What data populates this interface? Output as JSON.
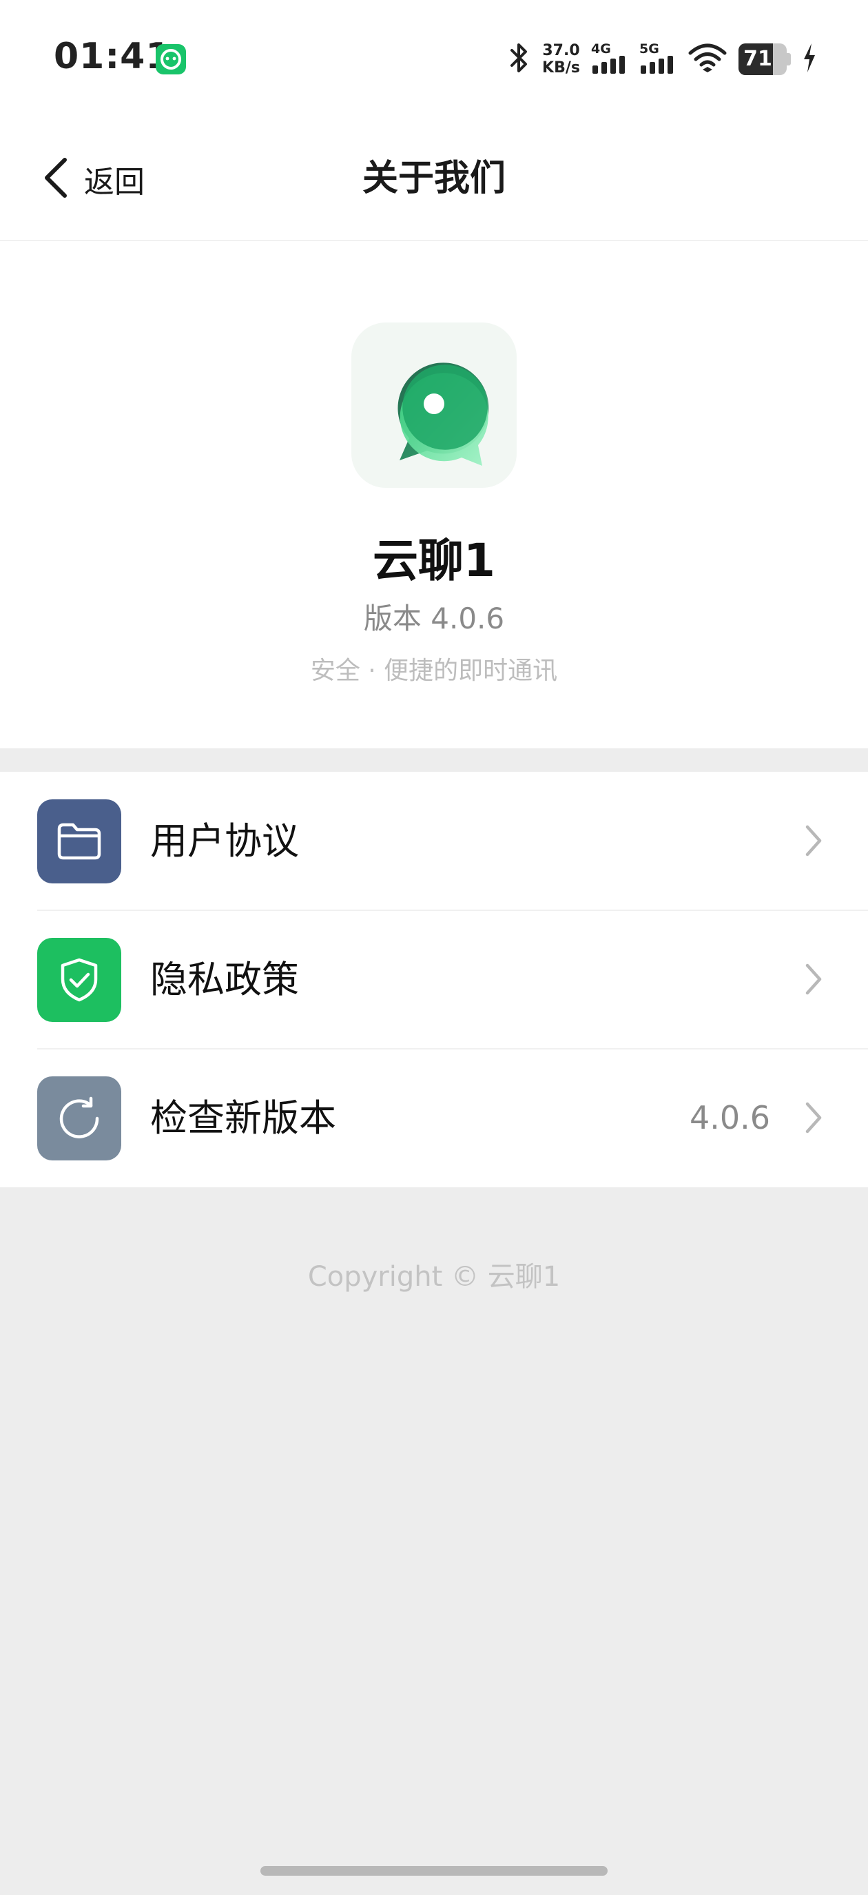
{
  "status_bar": {
    "time": "01:41",
    "speed_value": "37.0",
    "speed_unit": "KB/s",
    "net1": "4G",
    "net2": "5G",
    "battery": "71",
    "battery_level": 0.71,
    "icons": [
      "app-notification-icon",
      "bluetooth-icon",
      "signal-4g-icon",
      "signal-5g-icon",
      "wifi-icon",
      "battery-icon",
      "charging-bolt-icon"
    ]
  },
  "nav": {
    "back_label": "返回",
    "title": "关于我们"
  },
  "about": {
    "app_name": "云聊1",
    "version": "版本 4.0.6",
    "slogan": "安全 · 便捷的即时通讯"
  },
  "menu": {
    "items": [
      {
        "label": "用户协议",
        "value": "",
        "icon": "folder-icon",
        "color": "#4a5f8c"
      },
      {
        "label": "隐私政策",
        "value": "",
        "icon": "shield-check-icon",
        "color": "#1dbf60"
      },
      {
        "label": "检查新版本",
        "value": "4.0.6",
        "icon": "refresh-icon",
        "color": "#7a8b9d"
      }
    ]
  },
  "footer": {
    "copyright": "Copyright © 云聊1"
  },
  "colors": {
    "accent_green": "#1dbf60",
    "background": "#ededed",
    "surface": "#ffffff"
  }
}
